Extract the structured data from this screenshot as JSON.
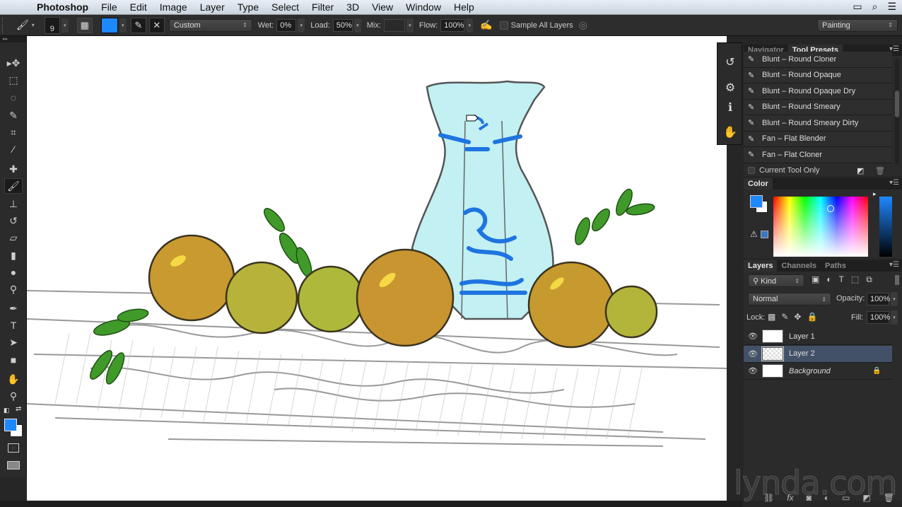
{
  "menubar": {
    "apple_icon": "apple-icon",
    "items": [
      "Photoshop",
      "File",
      "Edit",
      "Image",
      "Layer",
      "Type",
      "Select",
      "Filter",
      "3D",
      "View",
      "Window",
      "Help"
    ],
    "right_icons": [
      "screen-icon",
      "spotlight-icon",
      "list-icon"
    ]
  },
  "options": {
    "brush_size": "9",
    "foreground_color": "#1e88ff",
    "preset": "Custom",
    "wet_label": "Wet:",
    "wet_value": "0%",
    "load_label": "Load:",
    "load_value": "50%",
    "mix_label": "Mix:",
    "mix_value": "",
    "flow_label": "Flow:",
    "flow_value": "100%",
    "sample_all_layers_label": "Sample All Layers",
    "sample_all_layers_checked": false,
    "workspace": "Painting"
  },
  "tools": [
    {
      "name": "move-tool",
      "glyph": "▸✥"
    },
    {
      "name": "marquee-tool",
      "glyph": "⬚"
    },
    {
      "name": "lasso-tool",
      "glyph": "◌"
    },
    {
      "name": "quick-selection-tool",
      "glyph": "✎"
    },
    {
      "name": "crop-tool",
      "glyph": "⌗"
    },
    {
      "name": "eyedropper-tool",
      "glyph": "⁄"
    },
    {
      "name": "healing-brush-tool",
      "glyph": "✚"
    },
    {
      "name": "mixer-brush-tool",
      "glyph": "🖌"
    },
    {
      "name": "clone-stamp-tool",
      "glyph": "⊥"
    },
    {
      "name": "history-brush-tool",
      "glyph": "↺"
    },
    {
      "name": "eraser-tool",
      "glyph": "▱"
    },
    {
      "name": "gradient-tool",
      "glyph": "▮"
    },
    {
      "name": "blur-tool",
      "glyph": "●"
    },
    {
      "name": "dodge-tool",
      "glyph": "⚲"
    },
    {
      "name": "pen-tool",
      "glyph": "✒"
    },
    {
      "name": "type-tool",
      "glyph": "T"
    },
    {
      "name": "path-selection-tool",
      "glyph": "➤"
    },
    {
      "name": "rectangle-tool",
      "glyph": "■"
    },
    {
      "name": "hand-tool",
      "glyph": "✋"
    },
    {
      "name": "zoom-tool",
      "glyph": "⚲"
    }
  ],
  "swatches": {
    "foreground": "#1e88ff",
    "background": "#ffffff"
  },
  "tool_presets": {
    "tabs": [
      "Navigator",
      "Tool Presets"
    ],
    "active_tab": "Tool Presets",
    "items": [
      "Blunt – Round Cloner",
      "Blunt – Round Opaque",
      "Blunt – Round Opaque Dry",
      "Blunt – Round Smeary",
      "Blunt – Round Smeary Dirty",
      "Fan – Flat Blender",
      "Fan – Flat Cloner"
    ],
    "current_tool_only_label": "Current Tool Only"
  },
  "color_panel": {
    "title": "Color",
    "foreground": "#1e88ff",
    "background": "#ffffff",
    "web_safe_color": "#3a78c0"
  },
  "layers_panel": {
    "tabs": [
      "Layers",
      "Channels",
      "Paths"
    ],
    "active_tab": "Layers",
    "filter_kind": "Kind",
    "blend_mode": "Normal",
    "opacity_label": "Opacity:",
    "opacity": "100%",
    "lock_label": "Lock:",
    "fill_label": "Fill:",
    "fill": "100%",
    "layers": [
      {
        "name": "Layer 1",
        "visible": true,
        "selected": false,
        "locked": false
      },
      {
        "name": "Layer 2",
        "visible": true,
        "selected": true,
        "locked": false
      },
      {
        "name": "Background",
        "visible": true,
        "selected": false,
        "locked": true
      }
    ]
  },
  "watermark": "lynda.com"
}
